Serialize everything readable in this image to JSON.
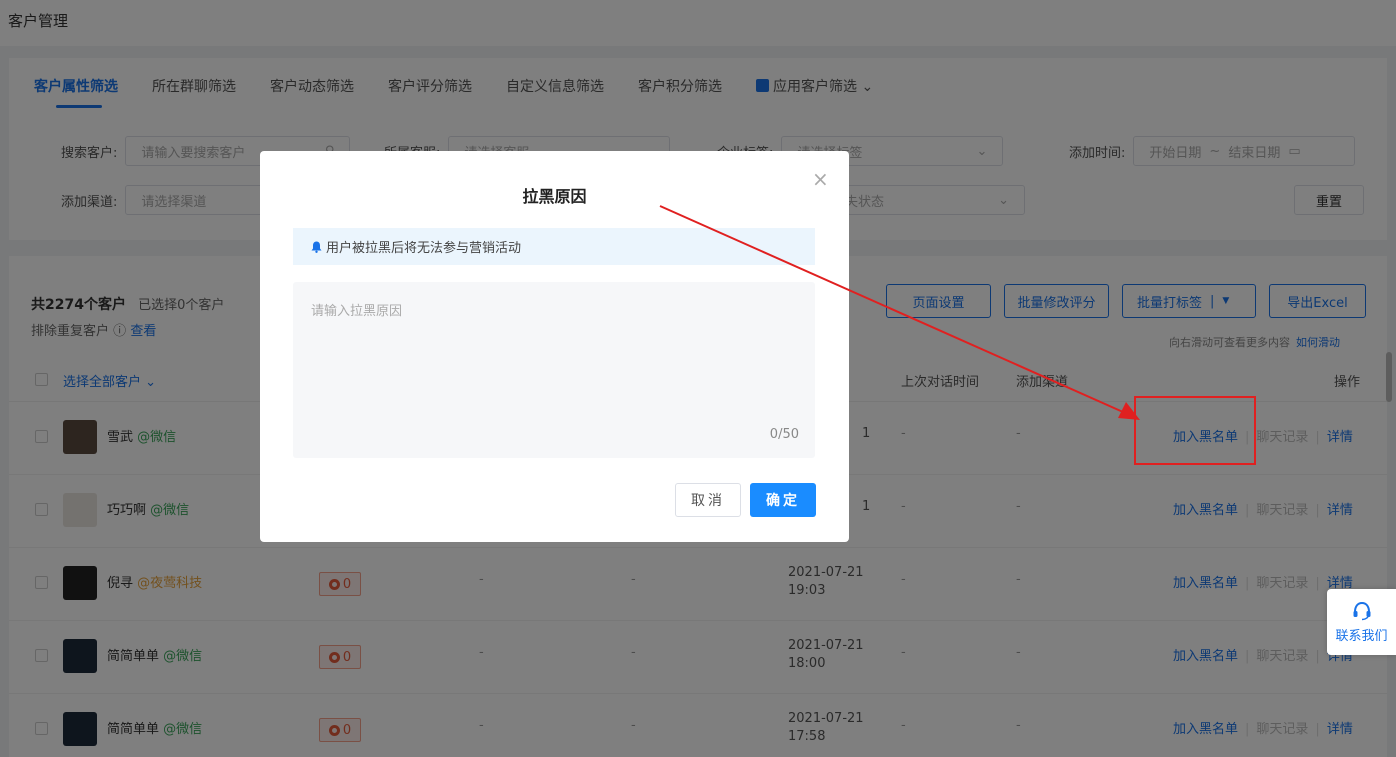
{
  "page": {
    "title": "客户管理"
  },
  "filter": {
    "tabs": [
      {
        "label": "客户属性筛选"
      },
      {
        "label": "所在群聊筛选"
      },
      {
        "label": "客户动态筛选"
      },
      {
        "label": "客户评分筛选"
      },
      {
        "label": "自定义信息筛选"
      },
      {
        "label": "客户积分筛选"
      },
      {
        "label": "应用客户筛选"
      }
    ],
    "search_label": "搜索客户:",
    "search_placeholder": "请输入要搜索客户",
    "owner_label": "所属客服:",
    "owner_placeholder": "请选择客服",
    "tag_label": "企业标签:",
    "tag_placeholder": "请选择标签",
    "time_label": "添加时间:",
    "time_start": "开始日期",
    "time_sep": "~",
    "time_end": "结束日期",
    "channel_label": "添加渠道:",
    "channel_placeholder": "请选择渠道",
    "loss_placeholder": "择流失状态",
    "reset_label": "重置"
  },
  "list": {
    "total": "共2274个客户",
    "selected": "已选择0个客户",
    "dedupe": "排除重复客户",
    "dedupe_link": "查看",
    "buttons": {
      "page_settings": "页面设置",
      "batch_score": "批量修改评分",
      "batch_tag": "批量打标签",
      "export": "导出Excel"
    },
    "scroll_tip": "向右滑动可查看更多内容",
    "scroll_link": "如何滑动",
    "headers": {
      "select_all": "选择全部客户",
      "last_chat": "上次对话时间",
      "add_channel": "添加渠道",
      "actions": "操作"
    },
    "rows": [
      {
        "name": "雪武",
        "source": "@微信",
        "source_type": "wx",
        "date": "",
        "time": "1"
      },
      {
        "name": "巧巧啊",
        "source": "@微信",
        "source_type": "wx",
        "date": "",
        "time": "1"
      },
      {
        "name": "倪寻",
        "source": "@夜莺科技",
        "source_type": "org",
        "score": "0",
        "date": "2021-07-21",
        "time": "19:03"
      },
      {
        "name": "简简单单",
        "source": "@微信",
        "source_type": "wx",
        "score": "0",
        "date": "2021-07-21",
        "time": "18:00"
      },
      {
        "name": "简简单单",
        "source": "@微信",
        "source_type": "wx",
        "score": "0",
        "date": "2021-07-21",
        "time": "17:58"
      }
    ],
    "actions": {
      "blacklist": "加入黑名单",
      "chat_log": "聊天记录",
      "detail": "详情"
    },
    "dash": "-"
  },
  "modal": {
    "title": "拉黑原因",
    "notice": "用户被拉黑后将无法参与营销活动",
    "placeholder": "请输入拉黑原因",
    "counter": "0/50",
    "cancel": "取消",
    "confirm": "确定"
  },
  "contact": {
    "label": "联系我们"
  },
  "colors": {
    "accent": "#1a73e8",
    "annotation": "#e02020"
  }
}
